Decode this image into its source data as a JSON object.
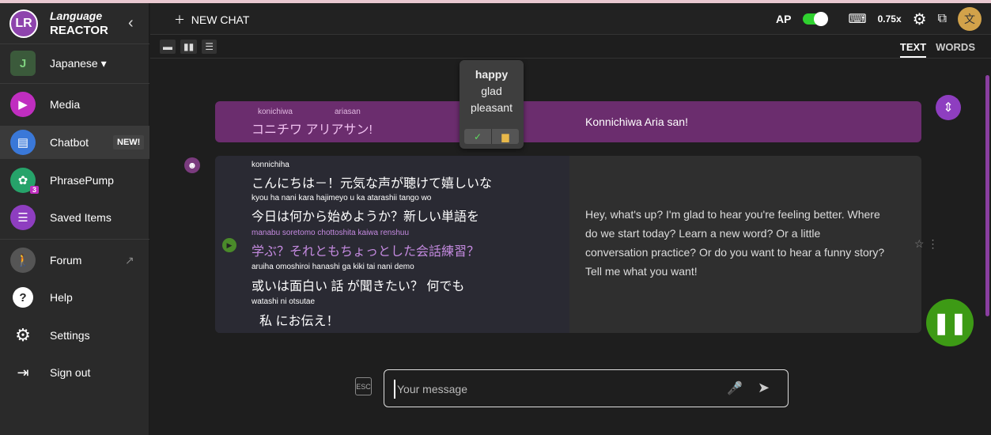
{
  "brand": {
    "top": "Language",
    "bottom": "REACTOR",
    "logo": "LR"
  },
  "sidebar": {
    "language": {
      "initial": "J",
      "label": "Japanese ▾"
    },
    "items": [
      {
        "label": "Media"
      },
      {
        "label": "Chatbot",
        "badge": "NEW!"
      },
      {
        "label": "PhrasePump",
        "count": "3"
      },
      {
        "label": "Saved Items"
      },
      {
        "label": "Forum"
      },
      {
        "label": "Help"
      },
      {
        "label": "Settings"
      },
      {
        "label": "Sign out"
      }
    ]
  },
  "header": {
    "new_chat": "NEW CHAT",
    "ap_label": "AP",
    "speed": "0.75x"
  },
  "tabs": {
    "text": "TEXT",
    "words": "WORDS"
  },
  "popup": {
    "words": [
      "happy",
      "glad",
      "pleasant"
    ]
  },
  "messages": [
    {
      "romaji": [
        "konichiwa",
        "ariasan"
      ],
      "japanese": "コニチワ アリアサン!",
      "translation": "Konnichiwa Aria san!"
    },
    {
      "lines": [
        {
          "romaji": "konnichiha",
          "text": "こんにちは－！元気な声が聴けて嬉しいな"
        },
        {
          "romaji": "kyou ha nani kara hajimeyo u ka atarashii tango wo",
          "text": "今日は何から始めようか？新しい単語を"
        },
        {
          "romaji": "manabu soretomo chottoshita kaiwa renshuu",
          "text": "学ぶ？それともちょっとした会話練習？"
        },
        {
          "romaji": "aruiha omoshiroi hanashi ga kiki tai nani demo",
          "text": "或いは面白い 話 が聞きたい？ 何でも"
        },
        {
          "romaji": "watashi ni otsutae",
          "text": "私 にお伝え！"
        }
      ],
      "translation": "Hey, what's up? I'm glad to hear you're feeling better. Where do we start today? Learn a new word? Or a little conversation practice? Or do you want to hear a funny story? Tell me what you want!"
    }
  ],
  "input": {
    "placeholder": "Your message",
    "esc": "ESC"
  },
  "colors": {
    "accent": "#8e3ec0",
    "user_bubble": "#6b2d6e",
    "pause": "#3d9a15"
  }
}
